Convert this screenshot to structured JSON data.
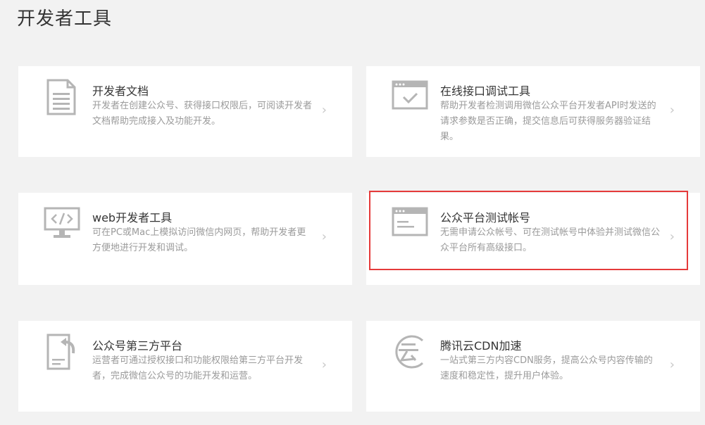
{
  "page": {
    "title": "开发者工具"
  },
  "cards": [
    {
      "title": "开发者文档",
      "desc": "开发者在创建公众号、获得接口权限后，可阅读开发者文档帮助完成接入及功能开发。",
      "icon": "document-icon"
    },
    {
      "title": "在线接口调试工具",
      "desc": "帮助开发者检测调用微信公众平台开发者API时发送的请求参数是否正确，提交信息后可获得服务器验证结果。",
      "icon": "browser-check-icon"
    },
    {
      "title": "web开发者工具",
      "desc": "可在PC或Mac上模拟访问微信内网页，帮助开发者更方便地进行开发和调试。",
      "icon": "monitor-code-icon"
    },
    {
      "title": "公众平台测试帐号",
      "desc": "无需申请公众帐号、可在测试帐号中体验并测试微信公众平台所有高级接口。",
      "icon": "browser-window-icon"
    },
    {
      "title": "公众号第三方平台",
      "desc": "运营者可通过授权接口和功能权限给第三方平台开发者，完成微信公众号的功能开发和运营。",
      "icon": "doc-return-icon"
    },
    {
      "title": "腾讯云CDN加速",
      "desc": "一站式第三方内容CDN服务，提高公众号内容传输的速度和稳定性，提升用户体验。",
      "icon": "cloud-cdn-icon"
    }
  ],
  "chevron": "›",
  "colors": {
    "icon": "#b5b5b5",
    "highlight": "#e53a3a"
  }
}
